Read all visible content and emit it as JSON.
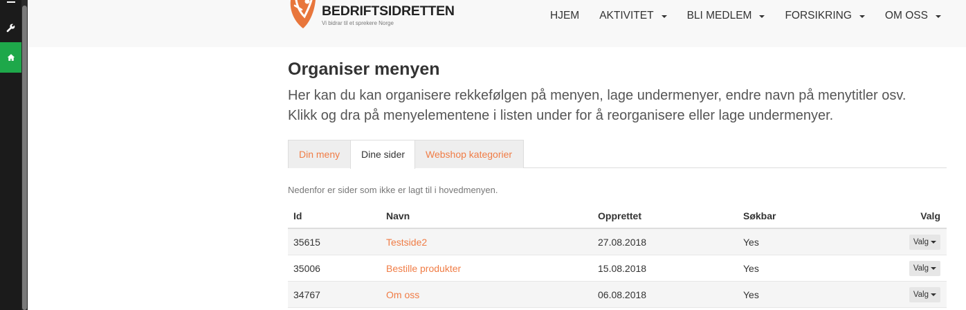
{
  "brand": {
    "name": "BEDRIFTSIDRETTEN",
    "tagline": "Vi bidrar til et sprekere Norge",
    "accent": "#f07c45"
  },
  "nav": {
    "items": [
      {
        "label": "HJEM",
        "dropdown": false
      },
      {
        "label": "AKTIVITET",
        "dropdown": true
      },
      {
        "label": "BLI MEDLEM",
        "dropdown": true
      },
      {
        "label": "FORSIKRING",
        "dropdown": true
      },
      {
        "label": "OM OSS",
        "dropdown": true
      }
    ]
  },
  "rail": {
    "icons": [
      "menu-icon",
      "wrench-icon",
      "home-icon"
    ],
    "active_color": "#1ea84a"
  },
  "page": {
    "title": "Organiser menyen",
    "intro_line1": "Her kan du kan organisere rekkefølgen på menyen, lage undermenyer, endre navn på menytitler osv.",
    "intro_line2": "Klikk og dra på menyelementene i listen under for å reorganisere eller lage undermenyer."
  },
  "tabs": [
    {
      "label": "Din meny",
      "active": false
    },
    {
      "label": "Dine sider",
      "active": true
    },
    {
      "label": "Webshop kategorier",
      "active": false
    }
  ],
  "note": "Nedenfor er sider som ikke er lagt til i hovedmenyen.",
  "table": {
    "headers": {
      "id": "Id",
      "navn": "Navn",
      "opprettet": "Opprettet",
      "sokbar": "Søkbar",
      "valg": "Valg"
    },
    "rows": [
      {
        "id": "35615",
        "navn": "Testside2",
        "opprettet": "27.08.2018",
        "sokbar": "Yes",
        "valg": "Valg"
      },
      {
        "id": "35006",
        "navn": "Bestille produkter",
        "opprettet": "15.08.2018",
        "sokbar": "Yes",
        "valg": "Valg"
      },
      {
        "id": "34767",
        "navn": "Om oss",
        "opprettet": "06.08.2018",
        "sokbar": "Yes",
        "valg": "Valg"
      }
    ]
  }
}
